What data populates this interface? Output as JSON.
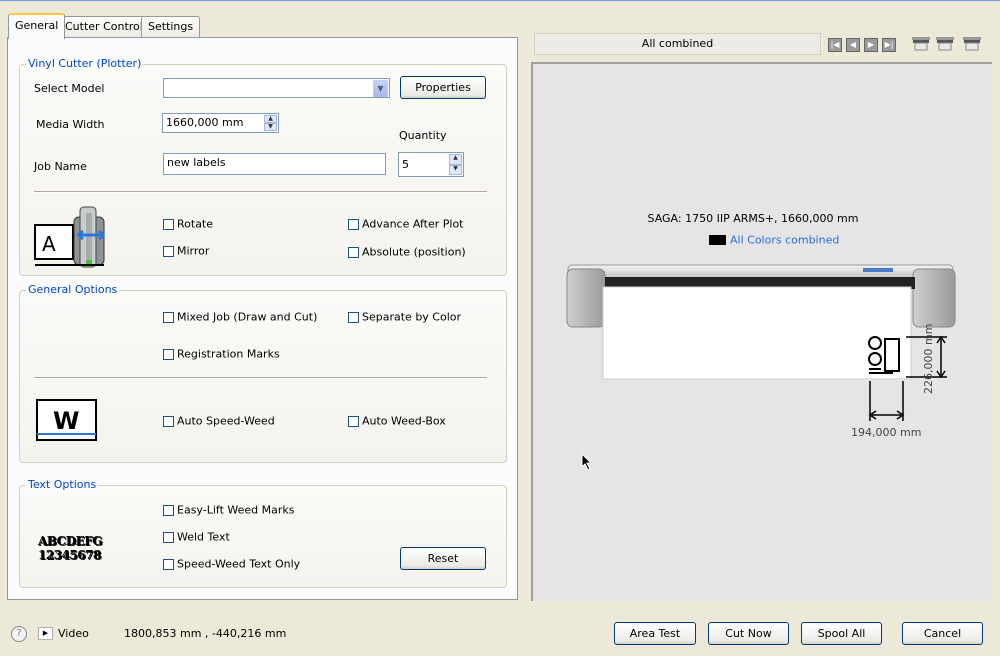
{
  "tabs": [
    "General",
    "Cutter Control",
    "Settings"
  ],
  "vinyl_cutter": {
    "title": "Vinyl Cutter (Plotter)",
    "select_model_label": "Select Model",
    "select_model_value": "",
    "properties_label": "Properties",
    "media_width_label": "Media Width",
    "media_width_value": "1660,000 mm",
    "quantity_label": "Quantity",
    "quantity_value": "5",
    "job_name_label": "Job Name",
    "job_name_value": "new labels",
    "rotate": "Rotate",
    "advance_after_plot": "Advance After Plot",
    "mirror": "Mirror",
    "absolute_position": "Absolute (position)",
    "icon_letter": "A"
  },
  "general_options": {
    "title": "General Options",
    "mixed_job": "Mixed Job (Draw and Cut)",
    "separate_by_color": "Separate by Color",
    "registration_marks": "Registration Marks",
    "auto_speed_weed": "Auto Speed-Weed",
    "auto_weed_box": "Auto Weed-Box",
    "icon_letter": "W"
  },
  "text_options": {
    "title": "Text Options",
    "easy_lift": "Easy-Lift Weed Marks",
    "weld_text": "Weld Text",
    "speed_weed_text_only": "Speed-Weed Text Only",
    "reset_label": "Reset",
    "sample_line1": "ABCDEFG",
    "sample_line2": "12345678"
  },
  "preview": {
    "view_title": "All combined",
    "device_caption": "SAGA: 1750 IIP ARMS+,  1660,000 mm",
    "color_caption": "All Colors combined",
    "color_swatch": "#000000",
    "height_dim": "226,000 mm",
    "width_dim": "194,000 mm"
  },
  "footer": {
    "video_label": "Video",
    "coords": "1800,853 mm , -440,216 mm",
    "area_test": "Area Test",
    "cut_now": "Cut Now",
    "spool_all": "Spool All",
    "cancel": "Cancel"
  },
  "colors": {
    "accent": "#0046d5",
    "link": "#2a6fe0",
    "tab_highlight": "#ffc83c"
  }
}
